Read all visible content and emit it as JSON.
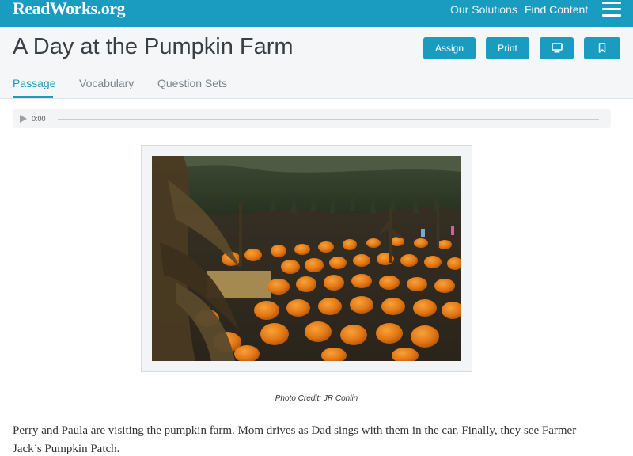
{
  "nav": {
    "logo_text": "ReadWorks",
    "logo_tld": ".org",
    "links": [
      "Our Solutions",
      "Find Content"
    ],
    "menu_icon": "hamburger-menu-icon"
  },
  "header": {
    "title": "A Day at the Pumpkin Farm",
    "buttons": {
      "assign": "Assign",
      "print": "Print",
      "present_icon": "monitor-icon",
      "bookmark_icon": "bookmark-icon"
    }
  },
  "tabs": [
    {
      "label": "Passage",
      "active": true
    },
    {
      "label": "Vocabulary",
      "active": false
    },
    {
      "label": "Question Sets",
      "active": false
    }
  ],
  "audio": {
    "time": "0:00",
    "progress": 0
  },
  "photo": {
    "credit": "Photo Credit: JR Conlin"
  },
  "passage": {
    "text": "Perry and Paula are visiting the pumpkin farm. Mom drives as Dad sings with them in the car. Finally, they see Farmer Jack’s Pumpkin Patch."
  },
  "colors": {
    "brand": "#1a9bc0",
    "text": "#333333"
  }
}
